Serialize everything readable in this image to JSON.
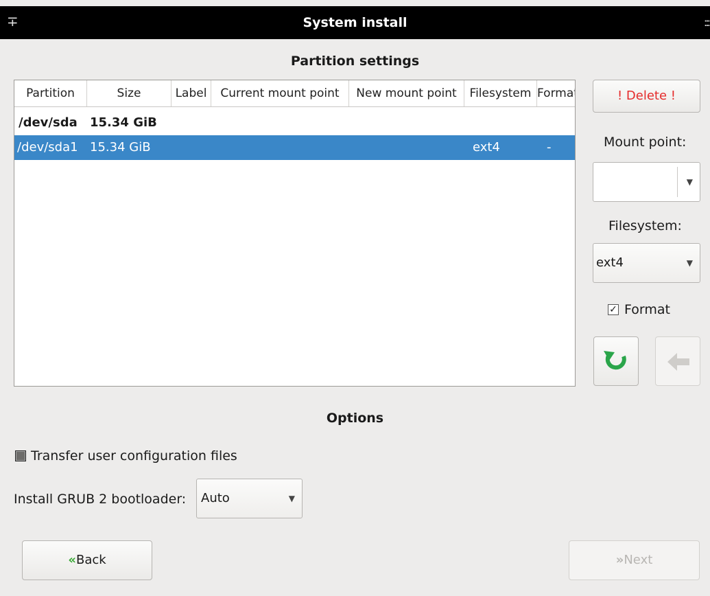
{
  "window": {
    "title": "System install"
  },
  "partition_section": {
    "title": "Partition settings"
  },
  "table": {
    "columns": [
      "Partition",
      "Size",
      "Label",
      "Current mount point",
      "New mount point",
      "Filesystem",
      "Format"
    ],
    "rows": [
      {
        "partition": "/dev/sda",
        "size": "15.34 GiB",
        "label": "",
        "current_mount": "",
        "new_mount": "",
        "filesystem": "",
        "format": ""
      },
      {
        "partition": "/dev/sda1",
        "size": "15.34 GiB",
        "label": "",
        "current_mount": "",
        "new_mount": "",
        "filesystem": "ext4",
        "format": "-"
      }
    ]
  },
  "side_panel": {
    "delete_label": "! Delete !",
    "mount_point_label": "Mount point:",
    "mount_point_value": "",
    "filesystem_label": "Filesystem:",
    "filesystem_value": "ext4",
    "format_checkbox": {
      "checked": true,
      "label": "Format"
    },
    "refresh_icon": "refresh-arrow-icon",
    "undo_icon": "left-arrow-icon"
  },
  "options_section": {
    "title": "Options",
    "transfer_checkbox_label": "Transfer user configuration files",
    "grub_label": "Install GRUB 2 bootloader:",
    "grub_value": "Auto"
  },
  "navigation": {
    "back_label": "Back",
    "next_label": "Next"
  },
  "colors": {
    "selection": "#3a87c8",
    "delete_text": "#e52b2b",
    "refresh_icon": "#2aa54a",
    "nav_arrow": "#39a935"
  }
}
